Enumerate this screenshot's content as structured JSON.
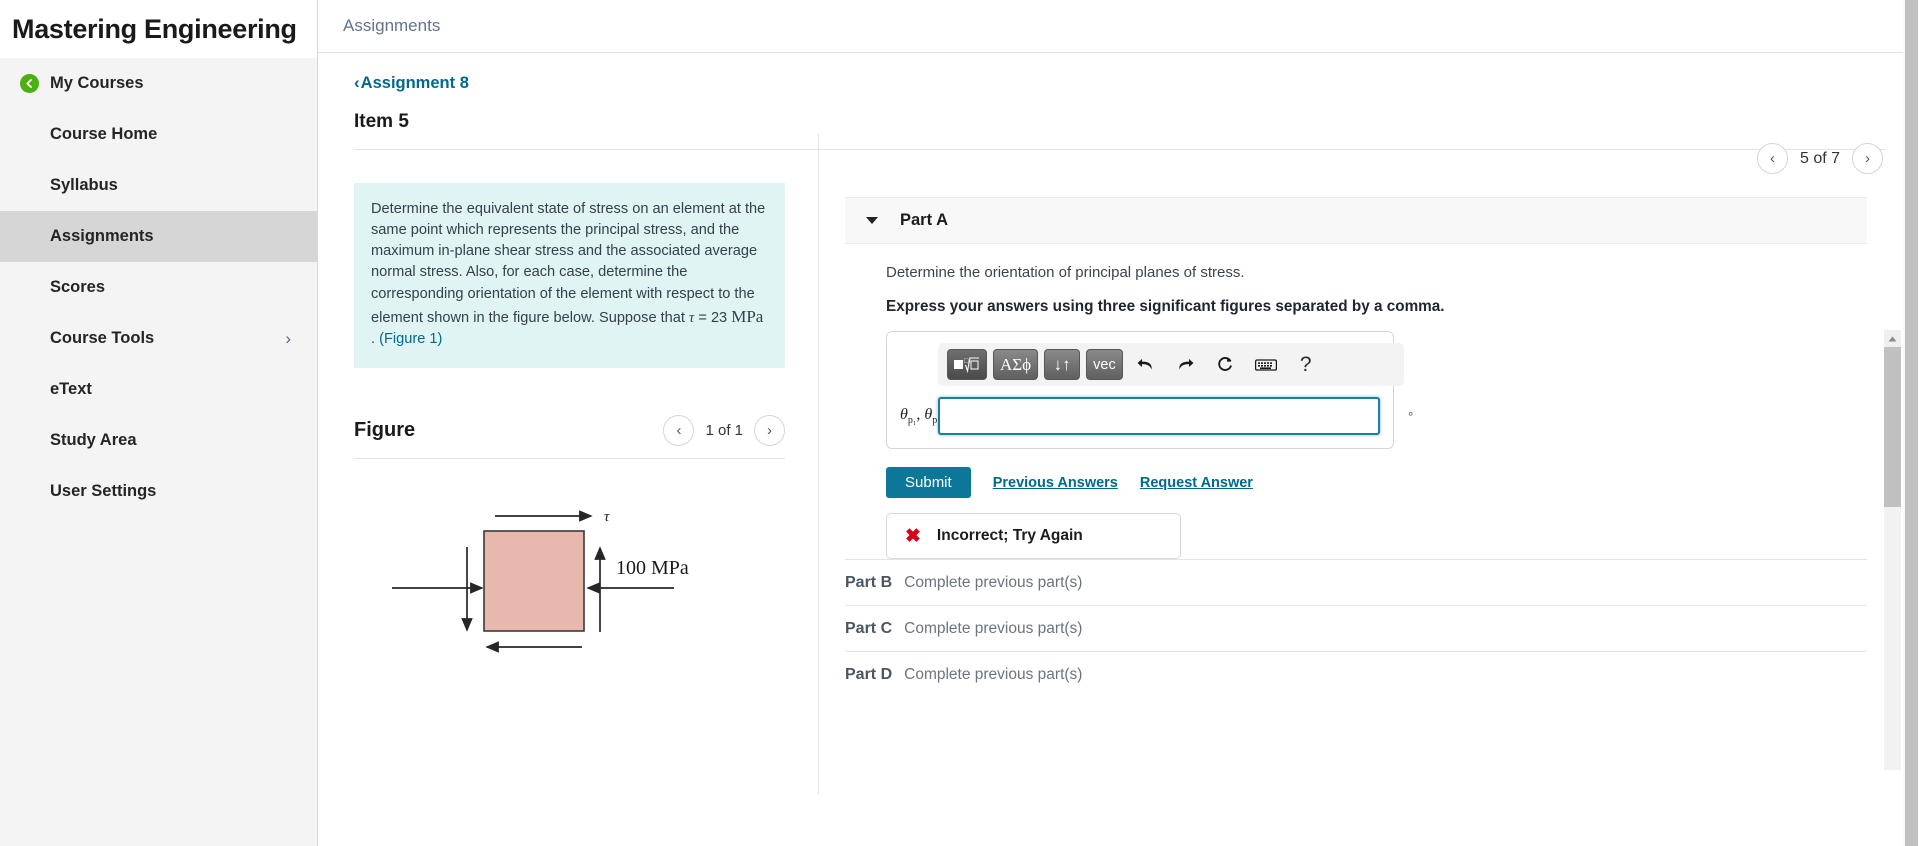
{
  "sidebar": {
    "brand_title": "Mastering Engineering",
    "items": [
      {
        "label": "My Courses",
        "icon": "back-circle-icon",
        "active": false,
        "chevron": ""
      },
      {
        "label": "Course Home",
        "icon": "",
        "active": false,
        "chevron": ""
      },
      {
        "label": "Syllabus",
        "icon": "",
        "active": false,
        "chevron": ""
      },
      {
        "label": "Assignments",
        "icon": "",
        "active": true,
        "chevron": ""
      },
      {
        "label": "Scores",
        "icon": "",
        "active": false,
        "chevron": ""
      },
      {
        "label": "Course Tools",
        "icon": "",
        "active": false,
        "chevron": "›"
      },
      {
        "label": "eText",
        "icon": "",
        "active": false,
        "chevron": ""
      },
      {
        "label": "Study Area",
        "icon": "",
        "active": false,
        "chevron": ""
      },
      {
        "label": "User Settings",
        "icon": "",
        "active": false,
        "chevron": ""
      }
    ]
  },
  "topbar": {
    "title": "Assignments"
  },
  "assignment": {
    "back_label": "Assignment 8",
    "back_chevron": "‹",
    "item_title": "Item 5",
    "pager": {
      "prev": "‹",
      "label": "5 of 7",
      "next": "›"
    }
  },
  "problem": {
    "text_before_tau": "Determine the equivalent state of stress on an element at the same point which represents the principal stress, and the maximum in-plane shear stress and the associated average normal stress. Also, for each case, determine the corresponding orientation of the element with respect to the element shown in the figure below. Suppose that",
    "tau_symbol": "τ",
    "equals": "=",
    "tau_value": "23",
    "tau_unit": "MPa",
    "period": ".",
    "figure_link": "(Figure 1)"
  },
  "figure": {
    "title": "Figure",
    "pager": {
      "prev": "‹",
      "label": "1 of 1",
      "next": "›"
    },
    "tau_label": "τ",
    "stress_label": "100 MPa",
    "element_fill": "#e8b8ad",
    "element_stroke": "#333333"
  },
  "part_a": {
    "caret": "▼",
    "label": "Part A",
    "prompt": "Determine the orientation of principal planes of stress.",
    "instruction": "Express your answers using three significant figures separated by a comma.",
    "toolbar": [
      {
        "name": "template-root-button",
        "glyph": "■√□"
      },
      {
        "name": "greek-symbols-button",
        "glyph": "ΑΣϕ"
      },
      {
        "name": "arrows-button",
        "glyph": "↓↑"
      },
      {
        "name": "vector-button",
        "glyph": "vec"
      },
      {
        "name": "undo-icon",
        "glyph": "↶"
      },
      {
        "name": "redo-icon",
        "glyph": "↷"
      },
      {
        "name": "reset-icon",
        "glyph": "↻"
      },
      {
        "name": "keyboard-icon",
        "glyph": "⌨"
      },
      {
        "name": "help-icon",
        "glyph": "?"
      }
    ],
    "answer_label_theta": "θ",
    "answer_label_sub1": "p₁",
    "answer_label_sub2": "p₂",
    "answer_label_equals": "=",
    "answer_value": "",
    "answer_placeholder": "",
    "unit": "°",
    "submit_label": "Submit",
    "previous_answers_label": "Previous Answers",
    "request_answer_label": "Request Answer",
    "feedback_icon": "✖",
    "feedback_text": "Incorrect; Try Again"
  },
  "other_parts": [
    {
      "label": "Part B",
      "status": "Complete previous part(s)"
    },
    {
      "label": "Part C",
      "status": "Complete previous part(s)"
    },
    {
      "label": "Part D",
      "status": "Complete previous part(s)"
    }
  ],
  "colors": {
    "accent_teal": "#0d7799",
    "link_blue": "#00698c",
    "problem_bg": "#e0f4f4",
    "sidebar_bg": "#f4f4f4",
    "active_nav": "#d6d6d6",
    "error_red": "#d60019",
    "green_badge": "#4caf12"
  }
}
